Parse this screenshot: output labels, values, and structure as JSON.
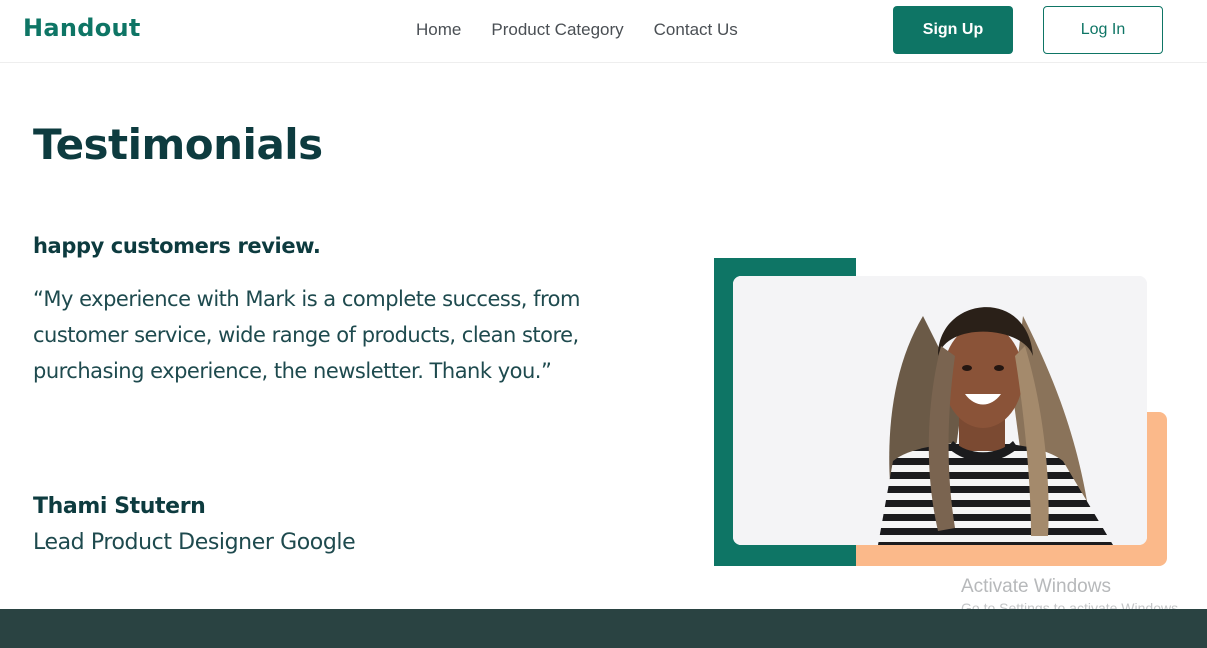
{
  "header": {
    "logo": "Handout",
    "nav": [
      "Home",
      "Product Category",
      "Contact Us"
    ],
    "signup_label": "Sign Up",
    "login_label": "Log In"
  },
  "testimonial": {
    "title": "Testimonials",
    "subtitle": "happy customers review.",
    "quote": "“My experience with Mark is a complete success, from customer service, wide range of products, clean store, purchasing experience, the newsletter. Thank you.”",
    "author": "Thami Stutern",
    "role": "Lead Product Designer Google"
  },
  "watermark": {
    "title": "Activate Windows",
    "subtitle": "Go to Settings to activate Windows."
  },
  "colors": {
    "brand": "#0e7565",
    "heading": "#0d3b3f",
    "accent_peach": "#fbb98a",
    "footer": "#2a4342"
  }
}
